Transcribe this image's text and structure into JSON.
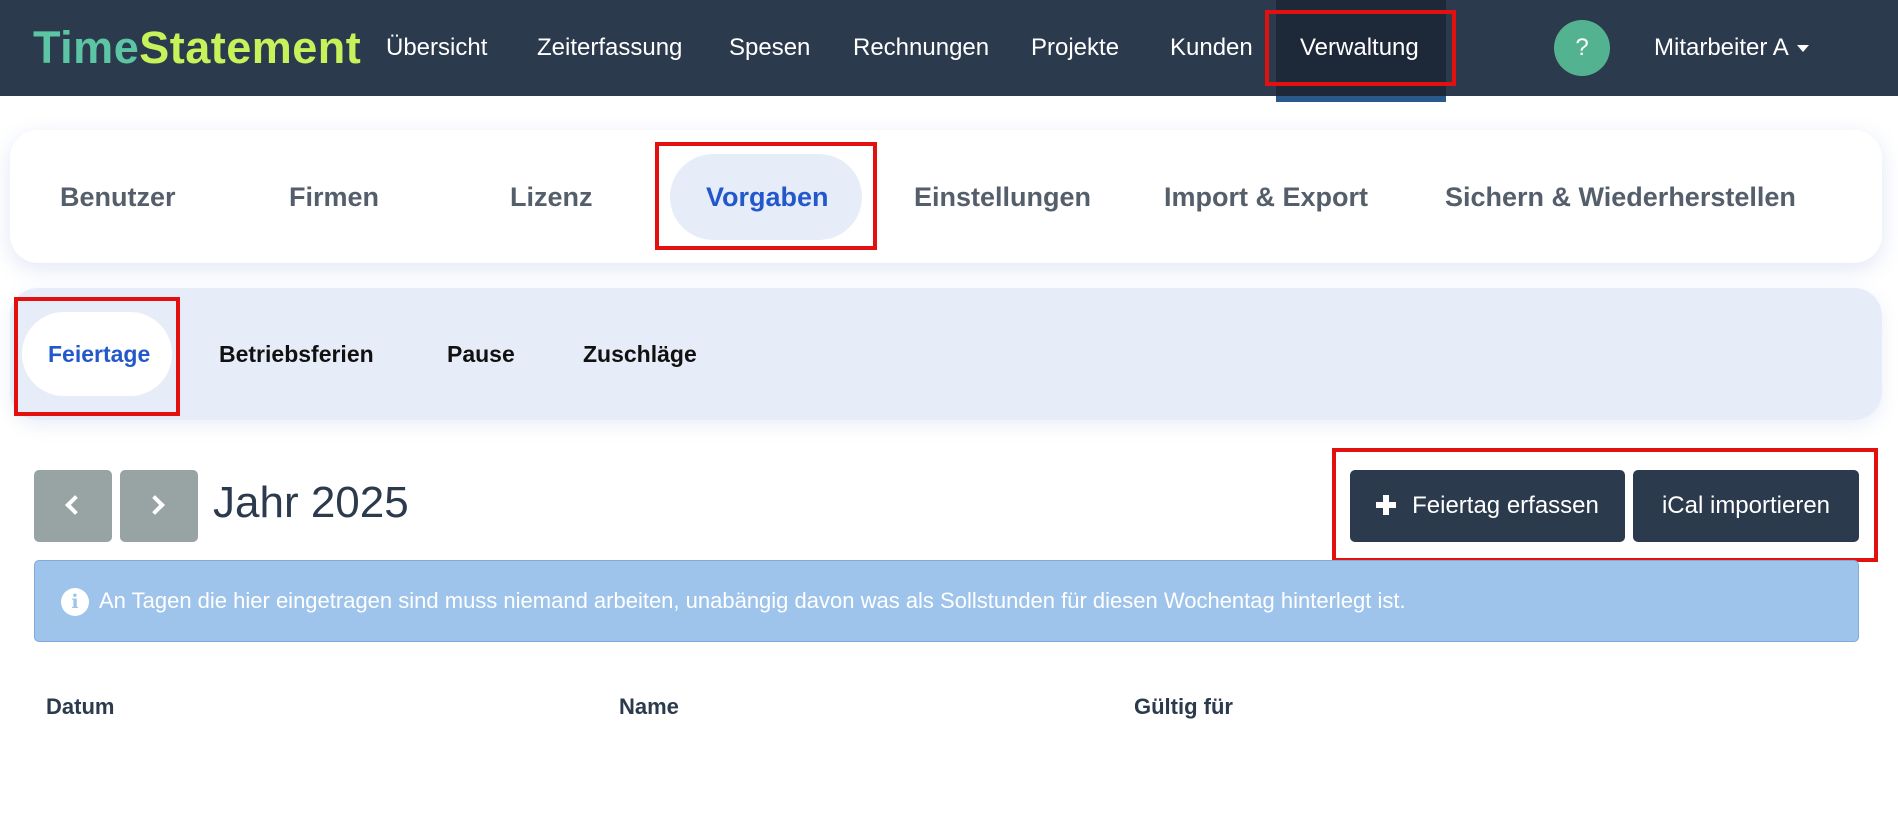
{
  "app": {
    "brand_part1": "Time",
    "brand_part2": "Statement"
  },
  "navbar": {
    "items": [
      {
        "label": "Übersicht"
      },
      {
        "label": "Zeiterfassung"
      },
      {
        "label": "Spesen"
      },
      {
        "label": "Rechnungen"
      },
      {
        "label": "Projekte"
      },
      {
        "label": "Kunden"
      },
      {
        "label": "Verwaltung",
        "active": true
      }
    ],
    "help_label": "?",
    "user_label": "Mitarbeiter A"
  },
  "tabs": [
    {
      "label": "Benutzer"
    },
    {
      "label": "Firmen"
    },
    {
      "label": "Lizenz"
    },
    {
      "label": "Vorgaben",
      "active": true
    },
    {
      "label": "Einstellungen"
    },
    {
      "label": "Import & Export"
    },
    {
      "label": "Sichern & Wiederherstellen"
    }
  ],
  "subtabs": [
    {
      "label": "Feiertage",
      "active": true
    },
    {
      "label": "Betriebsferien"
    },
    {
      "label": "Pause"
    },
    {
      "label": "Zuschläge"
    }
  ],
  "year": {
    "label": "Jahr 2025"
  },
  "actions": {
    "add_holiday": "Feiertag erfassen",
    "import_ical": "iCal importieren"
  },
  "alert": {
    "icon_label": "i",
    "text": "An Tagen die hier eingetragen sind muss niemand arbeiten, unabängig davon was als Sollstunden für diesen Wochentag hinterlegt ist."
  },
  "table": {
    "columns": [
      "Datum",
      "Name",
      "Gültig für"
    ]
  },
  "icons": {
    "prev": "chevron-left-icon",
    "next": "chevron-right-icon",
    "add": "plus-icon",
    "info": "info-circle-icon",
    "user_menu": "caret-down-icon"
  },
  "colors": {
    "navbar_bg": "#2c3a4d",
    "brand_time": "#5cc6a4",
    "brand_statement": "#c9f25a",
    "accent_blue": "#2358cc",
    "help_green": "#53b391",
    "alert_bg": "#9ec4ec",
    "highlight_red": "#e31010"
  }
}
